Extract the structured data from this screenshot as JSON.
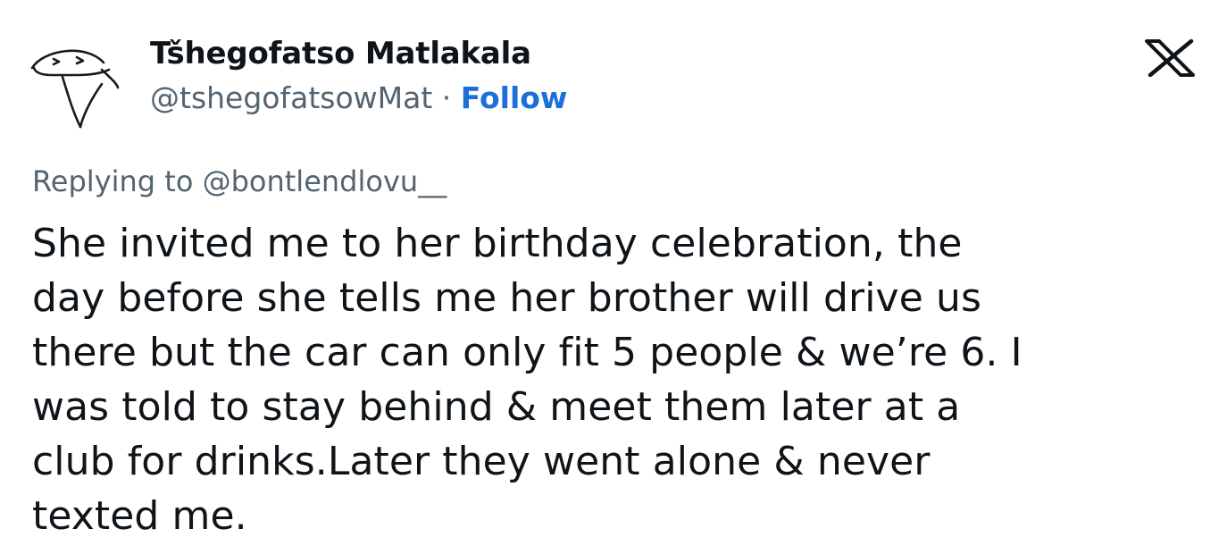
{
  "author": {
    "display_name": "Tšhegofatso Matlakala",
    "handle": "@tshegofatsowMat",
    "separator": " · ",
    "follow_label": "Follow"
  },
  "icons": {
    "avatar": "sketch-face-avatar",
    "brand": "x-logo-icon"
  },
  "reply": {
    "text": "Replying to @bontlendlovu__"
  },
  "tweet": {
    "text": "She invited me to her birthday celebration, the\nday before she tells me her brother will drive us\nthere but the car can only fit 5 people & we’re 6. I\nwas told to stay behind & meet them later at a\nclub for drinks.Later they went alone & never\ntexted me."
  },
  "colors": {
    "text": "#0f1419",
    "secondary": "#536471",
    "follow": "#1d6fd8",
    "background": "#ffffff"
  }
}
